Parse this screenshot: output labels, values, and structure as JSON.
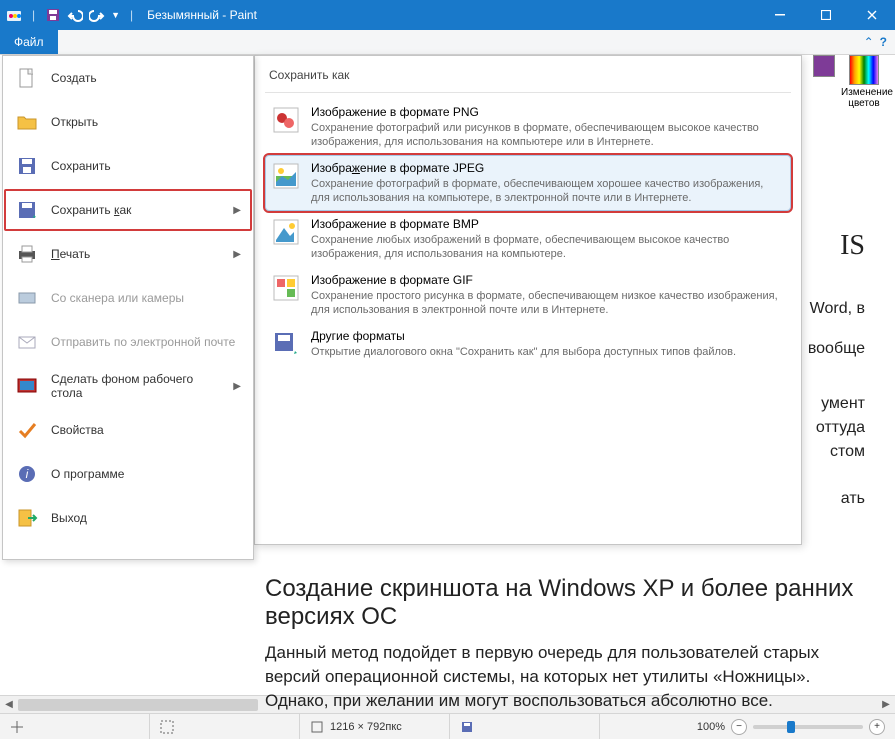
{
  "titlebar": {
    "title": "Безымянный - Paint"
  },
  "ribbon": {
    "file": "Файл"
  },
  "colors": {
    "edit_label": "Изменение\nцветов"
  },
  "backstage": {
    "items": [
      {
        "label": "Создать"
      },
      {
        "label": "Открыть"
      },
      {
        "label": "Сохранить"
      },
      {
        "label_pre": "Сохранить ",
        "label_u": "к",
        "label_post": "ак"
      },
      {
        "label_u": "П",
        "label_post": "ечать"
      },
      {
        "label": "Со сканера или камеры"
      },
      {
        "label": "Отправить по электронной почте"
      },
      {
        "label": "Сделать фоном рабочего стола"
      },
      {
        "label": "Свойства"
      },
      {
        "label": "О программе"
      },
      {
        "label": "Выход"
      }
    ]
  },
  "submenu": {
    "title": "Сохранить как",
    "items": [
      {
        "hdr": "Изображение в формате PNG",
        "desc": "Сохранение фотографий или рисунков в формате, обеспечивающем высокое качество изображения, для использования на компьютере или в Интернете."
      },
      {
        "hdr_pre": "Изобра",
        "hdr_u": "ж",
        "hdr_post": "ение в формате JPEG",
        "desc": "Сохранение фотографий в формате, обеспечивающем хорошее качество изображения, для использования на компьютере, в электронной почте или в Интернете."
      },
      {
        "hdr": "Изображение в формате BMP",
        "desc": "Сохранение любых изображений в формате, обеспечивающем высокое качество изображения, для использования на компьютере."
      },
      {
        "hdr": "Изображение в формате GIF",
        "desc": "Сохранение простого рисунка в формате, обеспечивающем низкое качество изображения, для использования в электронной почте или в Интернете."
      },
      {
        "hdr": "Другие форматы",
        "desc": "Открытие диалогового окна \"Сохранить как\" для выбора доступных типов файлов."
      }
    ]
  },
  "content": {
    "frag1": "IS",
    "frag2": "Word, в",
    "frag3": "вообще",
    "frag4": "умент",
    "frag5": "оттуда",
    "frag6": "стом",
    "frag7": "ать",
    "h2": "Создание скриншота на Windows XP и более ранних версиях ОС",
    "p2": "Данный метод подойдет в первую очередь для пользователей старых версий операционной системы, на которых нет утилиты «Ножницы». Однако, при желании им могут воспользоваться абсолютно все."
  },
  "status": {
    "cursor": "",
    "sel": "",
    "size": "1216 × 792пкс",
    "disk": "",
    "zoom": "100%"
  }
}
